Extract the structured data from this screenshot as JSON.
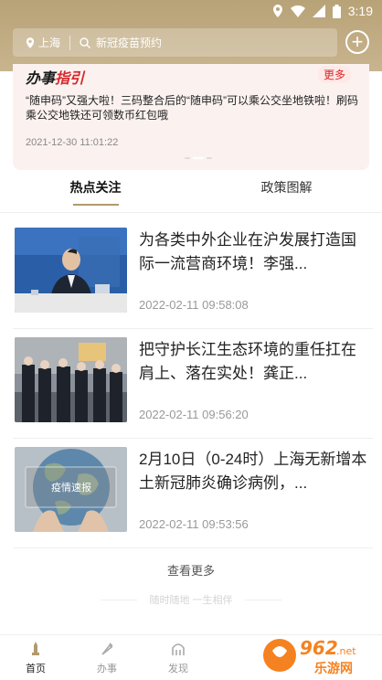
{
  "status_bar": {
    "time": "3:19"
  },
  "header": {
    "location": "上海",
    "search_placeholder": "新冠疫苗预约"
  },
  "banner": {
    "brand_black": "办事",
    "brand_red": "指引",
    "more": "更多",
    "text": "“随申码”又强大啦！三码整合后的“随申码”可以乘公交坐地铁啦！刷码乘公交地铁还可领数币红包哦",
    "date": "2021-12-30 11:01:22"
  },
  "tabs": [
    {
      "label": "热点关注",
      "active": true
    },
    {
      "label": "政策图解",
      "active": false
    }
  ],
  "news": [
    {
      "title": "为各类中外企业在沪发展打造国际一流营商环境！李强...",
      "time": "2022-02-11 09:58:08",
      "thumb": "meeting"
    },
    {
      "title": "把守护长江生态环境的重任扛在肩上、落在实处！龚正...",
      "time": "2022-02-11 09:56:20",
      "thumb": "inspection"
    },
    {
      "title": "2月10日（0-24时）上海无新增本土新冠肺炎确诊病例，...",
      "time": "2022-02-11 09:53:56",
      "thumb": "globe",
      "thumb_label": "疫情速报"
    }
  ],
  "more_label": "查看更多",
  "slogan": "随时随地 一生相伴",
  "bottom_nav": [
    {
      "label": "首页",
      "icon": "home-icon",
      "active": true
    },
    {
      "label": "办事",
      "icon": "service-icon",
      "active": false
    },
    {
      "label": "发现",
      "icon": "discover-icon",
      "active": false
    },
    {
      "label": "",
      "icon": "",
      "active": false
    }
  ],
  "watermark": {
    "text_top": "962",
    "text_bottom": "乐游网",
    "domain": ".net"
  },
  "colors": {
    "gold": "#b8a277",
    "red": "#d8282b",
    "muted": "#999999"
  }
}
